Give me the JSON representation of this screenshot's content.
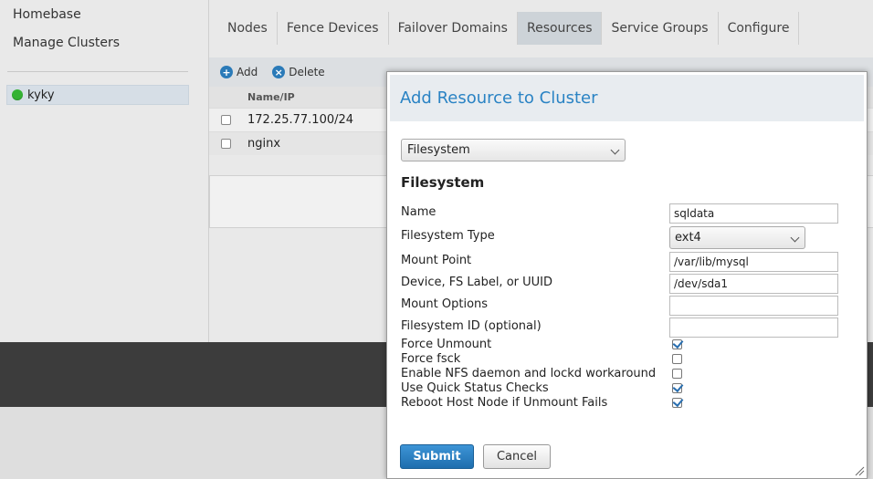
{
  "nav": {
    "homebase": "Homebase",
    "manage_clusters": "Manage Clusters",
    "cluster_name": "kyky",
    "cluster_status_color": "#34b233"
  },
  "tabs": [
    {
      "label": "Nodes"
    },
    {
      "label": "Fence Devices"
    },
    {
      "label": "Failover Domains"
    },
    {
      "label": "Resources",
      "active": true
    },
    {
      "label": "Service Groups"
    },
    {
      "label": "Configure"
    }
  ],
  "toolbar": {
    "add_label": "Add",
    "delete_label": "Delete",
    "add_icon": "plus-circle-icon",
    "delete_icon": "x-circle-icon"
  },
  "resources": {
    "column_header": "Name/IP",
    "rows": [
      {
        "name": "172.25.77.100/24"
      },
      {
        "name": "nginx"
      }
    ]
  },
  "dialog": {
    "title": "Add Resource to Cluster",
    "resource_type": "Filesystem",
    "section_title": "Filesystem",
    "fields": {
      "name": {
        "label": "Name",
        "value": "sqldata"
      },
      "fs_type": {
        "label": "Filesystem Type",
        "value": "ext4"
      },
      "mount_point": {
        "label": "Mount Point",
        "value": "/var/lib/mysql"
      },
      "device": {
        "label": "Device, FS Label, or UUID",
        "value": "/dev/sda1"
      },
      "mount_options": {
        "label": "Mount Options",
        "value": ""
      },
      "fs_id": {
        "label": "Filesystem ID (optional)",
        "value": ""
      }
    },
    "checkboxes": [
      {
        "label": "Force Unmount",
        "checked": true
      },
      {
        "label": "Force fsck",
        "checked": false
      },
      {
        "label": "Enable NFS daemon and lockd workaround",
        "checked": false
      },
      {
        "label": "Use Quick Status Checks",
        "checked": true
      },
      {
        "label": "Reboot Host Node if Unmount Fails",
        "checked": true
      }
    ],
    "submit_label": "Submit",
    "cancel_label": "Cancel",
    "accent_color": "#2a83c4"
  }
}
